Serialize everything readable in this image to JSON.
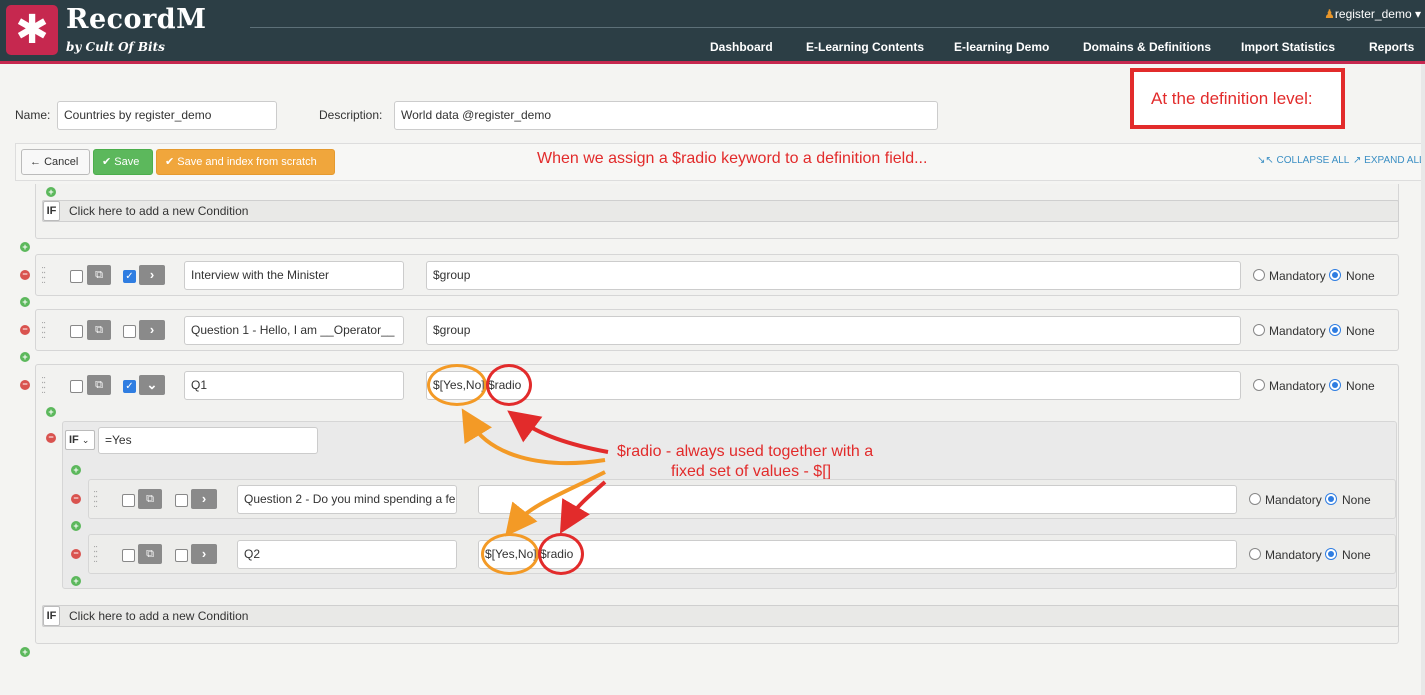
{
  "app": {
    "logo_glyph": "✱",
    "title": "RecordM",
    "subtitle": "by Cult Of Bits",
    "accent": "#c6284f",
    "header_bg": "#2c3e45"
  },
  "user_menu": {
    "icon": "person-icon",
    "label": "register_demo",
    "caret": "▾"
  },
  "nav": {
    "items": [
      "Dashboard",
      "E-Learning Contents",
      "E-learning Demo",
      "Domains & Definitions",
      "Import Statistics",
      "Reports"
    ]
  },
  "form": {
    "name_label": "Name:",
    "name_value": "Countries by register_demo",
    "description_label": "Description:",
    "description_value": "World data @register_demo"
  },
  "toolbar": {
    "cancel_label": "Cancel",
    "cancel_icon": "←",
    "save_label": "Save",
    "save_icon": "✔",
    "save_index_label": "Save and index from scratch",
    "save_index_icon": "✔",
    "collapse_label": "COLLAPSE ALL",
    "expand_label": "EXPAND ALL"
  },
  "annotations": {
    "definition_level": "At the definition level:",
    "assign_radio": "When we assign a $radio keyword to a definition field...",
    "radio_note_line1": "$radio - always used together with a",
    "radio_note_line2": "fixed set of values - $[]"
  },
  "conditions": {
    "if_label": "IF",
    "add_condition": "Click here to add a new Condition",
    "nested_if_value": "=Yes"
  },
  "fields": [
    {
      "name": "Interview with the Minister",
      "description": "$group",
      "checked": true,
      "expanded": false
    },
    {
      "name": "Question 1 - Hello, I am __Operator__",
      "description": "$group",
      "checked": false,
      "expanded": false
    },
    {
      "name": "Q1",
      "description_a": "$[Yes,No]",
      "description_b": "$radio",
      "checked": true,
      "expanded": true
    }
  ],
  "nested_fields": [
    {
      "name": "Question 2 - Do you mind spending a fe",
      "description": "",
      "checked": false
    },
    {
      "name": "Q2",
      "description_a": "$[Yes,No]",
      "description_b": "$radio",
      "checked": false
    }
  ],
  "radio": {
    "mandatory_label": "Mandatory",
    "none_label": "None",
    "selected": "None"
  },
  "icons": {
    "plus": "+",
    "minus": "−",
    "grip": "⋮⋮",
    "copy": "⧉",
    "arrow_right": "›",
    "chevron_down": "⌄"
  }
}
